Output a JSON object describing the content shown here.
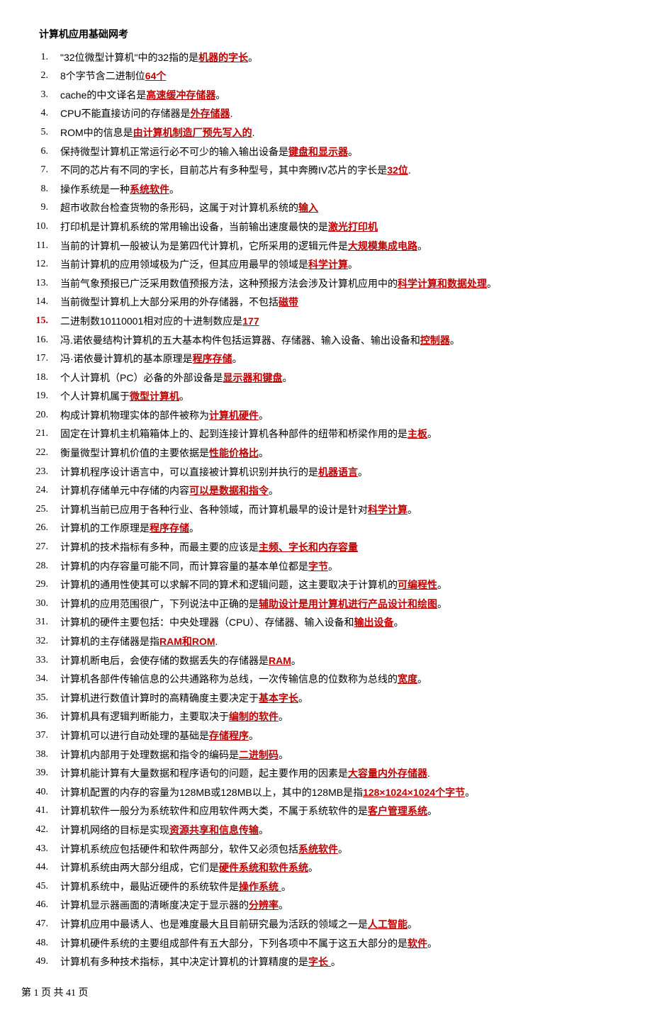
{
  "title": "计算机应用基础网考",
  "footer": "第 1 页 共 41 页",
  "items": [
    {
      "pre": "\"32位微型计算机\"中的32指的是",
      "ans": "机器的字长",
      "post": "。",
      "redNum": false
    },
    {
      "pre": "8个字节含二进制位",
      "ans": "64个",
      "post": "",
      "redNum": false
    },
    {
      "pre": "cache的中文译名是",
      "ans": "高速缓冲存储器",
      "post": "。",
      "redNum": false
    },
    {
      "pre": "CPU不能直接访问的存储器是",
      "ans": "外存储器",
      "post": ".",
      "redNum": false
    },
    {
      "pre": "ROM中的信息是",
      "ans": "由计算机制造厂预先写入的",
      "post": ".",
      "redNum": false
    },
    {
      "pre": "保持微型计算机正常运行必不可少的输入输出设备是",
      "ans": "键盘和显示器",
      "post": "。",
      "redNum": false
    },
    {
      "pre": "不同的芯片有不同的字长，目前芯片有多种型号，其中奔腾IV芯片的字长是",
      "ans": "32位",
      "post": ".",
      "redNum": false
    },
    {
      "pre": "操作系统是一种",
      "ans": "系统软件",
      "post": "。",
      "redNum": false
    },
    {
      "pre": "超市收款台检查货物的条形码，这属于对计算机系统的",
      "ans": "输入",
      "post": "",
      "redNum": false
    },
    {
      "pre": "打印机是计算机系统的常用输出设备，当前输出速度最快的是",
      "ans": "激光打印机",
      "post": "",
      "redNum": false
    },
    {
      "pre": "当前的计算机一般被认为是第四代计算机，它所采用的逻辑元件是",
      "ans": "大规模集成电路",
      "post": "。",
      "redNum": false
    },
    {
      "pre": "当前计算机的应用领域极为广泛，但其应用最早的领域是",
      "ans": "科学计算",
      "post": "。",
      "redNum": false
    },
    {
      "pre": "当前气象预报已广泛采用数值预报方法，这种预报方法会涉及计算机应用中的",
      "ans": "科学计算和数据处理",
      "post": "。",
      "redNum": false
    },
    {
      "pre": "当前微型计算机上大部分采用的外存储器，不包括",
      "ans": "磁带",
      "post": "",
      "redNum": false
    },
    {
      "pre": "二进制数10110001相对应的十进制数应是",
      "ans": "177",
      "post": "",
      "redNum": true
    },
    {
      "pre": "冯.诺依曼结构计算机的五大基本构件包括运算器、存储器、输入设备、输出设备和",
      "ans": "控制器",
      "post": "。",
      "redNum": false
    },
    {
      "pre": "冯·诺依曼计算机的基本原理是",
      "ans": "程序存储",
      "post": "。",
      "redNum": false
    },
    {
      "pre": "个人计算机（PC）必备的外部设备是",
      "ans": "显示器和键盘",
      "post": "。",
      "redNum": false
    },
    {
      "pre": "个人计算机属于",
      "ans": "微型计算机",
      "post": "。",
      "redNum": false
    },
    {
      "pre": "构成计算机物理实体的部件被称为",
      "ans": "计算机硬件",
      "post": "。",
      "redNum": false
    },
    {
      "pre": "固定在计算机主机箱箱体上的、起到连接计算机各种部件的纽带和桥梁作用的是",
      "ans": "主板",
      "post": "。",
      "redNum": false
    },
    {
      "pre": "衡量微型计算机价值的主要依据是",
      "ans": "性能价格比",
      "post": "。",
      "redNum": false
    },
    {
      "pre": "计算机程序设计语言中，可以直接被计算机识别并执行的是",
      "ans": "机器语言",
      "post": "。",
      "redNum": false
    },
    {
      "pre": "计算机存储单元中存储的内容",
      "ans": "可以是数据和指令",
      "post": "。",
      "redNum": false
    },
    {
      "pre": "计算机当前已应用于各种行业、各种领域，而计算机最早的设计是针对",
      "ans": "科学计算",
      "post": "。",
      "redNum": false
    },
    {
      "pre": "计算机的工作原理是",
      "ans": "程序存储",
      "post": "。",
      "redNum": false
    },
    {
      "pre": "计算机的技术指标有多种，而最主要的应该是",
      "ans": "主频、字长和内存容量",
      "post": "",
      "redNum": false
    },
    {
      "pre": "计算机的内存容量可能不同，而计算容量的基本单位都是",
      "ans": "字节",
      "post": "。",
      "redNum": false
    },
    {
      "pre": "计算机的通用性使其可以求解不同的算术和逻辑问题，这主要取决于计算机的",
      "ans": "可编程性",
      "post": "。",
      "redNum": false
    },
    {
      "pre": "计算机的应用范围很广，下列说法中正确的是",
      "ans": "辅助设计是用计算机进行产品设计和绘图",
      "post": "。",
      "redNum": false
    },
    {
      "pre": "计算机的硬件主要包括：中央处理器（CPU）、存储器、输入设备和",
      "ans": "输出设备",
      "post": "。",
      "redNum": false
    },
    {
      "pre": "计算机的主存储器是指",
      "ans": "RAM和ROM",
      "post": ".",
      "redNum": false
    },
    {
      "pre": "计算机断电后，会使存储的数据丢失的存储器是",
      "ans": "RAM",
      "post": "。",
      "redNum": false
    },
    {
      "pre": "计算机各部件传输信息的公共通路称为总线，一次传输信息的位数称为总线的",
      "ans": "宽度",
      "post": "。",
      "redNum": false
    },
    {
      "pre": "计算机进行数值计算时的高精确度主要决定于",
      "ans": "基本字长",
      "post": "。",
      "redNum": false
    },
    {
      "pre": "计算机具有逻辑判断能力，主要取决于",
      "ans": "编制的软件",
      "post": "。",
      "redNum": false
    },
    {
      "pre": "计算机可以进行自动处理的基础是",
      "ans": "存储程序",
      "post": "。",
      "redNum": false
    },
    {
      "pre": "计算机内部用于处理数据和指令的编码是",
      "ans": "二进制码",
      "post": "。",
      "redNum": false
    },
    {
      "pre": "计算机能计算有大量数据和程序语句的问题，起主要作用的因素是",
      "ans": "大容量内外存储器",
      "post": ".",
      "redNum": false
    },
    {
      "pre": "计算机配置的内存的容量为128MB或128MB以上，其中的128MB是指",
      "ans": "128×1024×1024个字节",
      "post": "。",
      "redNum": false
    },
    {
      "pre": "计算机软件一般分为系统软件和应用软件两大类，不属于系统软件的是",
      "ans": "客户管理系统",
      "post": "。",
      "redNum": false
    },
    {
      "pre": "计算机网络的目标是实现",
      "ans": "资源共享和信息传输",
      "post": "。",
      "redNum": false
    },
    {
      "pre": "计算机系统应包括硬件和软件两部分，软件又必须包括",
      "ans": "系统软件",
      "post": "。",
      "redNum": false
    },
    {
      "pre": "计算机系统由两大部分组成，它们是",
      "ans": "硬件系统和软件系统",
      "post": "。",
      "redNum": false
    },
    {
      "pre": "计算机系统中，最贴近硬件的系统软件是",
      "ans": "操作系统 ",
      "post": "。",
      "redNum": false
    },
    {
      "pre": "计算机显示器画面的清晰度决定于显示器的",
      "ans": "分辨率",
      "post": "。",
      "redNum": false
    },
    {
      "pre": "计算机应用中最诱人、也是难度最大且目前研究最为活跃的领域之一是",
      "ans": "人工智能",
      "post": "。",
      "redNum": false
    },
    {
      "pre": "计算机硬件系统的主要组成部件有五大部分，下列各项中不属于这五大部分的是",
      "ans": "软件",
      "post": "。",
      "redNum": false
    },
    {
      "pre": "计算机有多种技术指标，其中决定计算机的计算精度的是",
      "ans": "字长 ",
      "post": "。",
      "redNum": false
    }
  ]
}
